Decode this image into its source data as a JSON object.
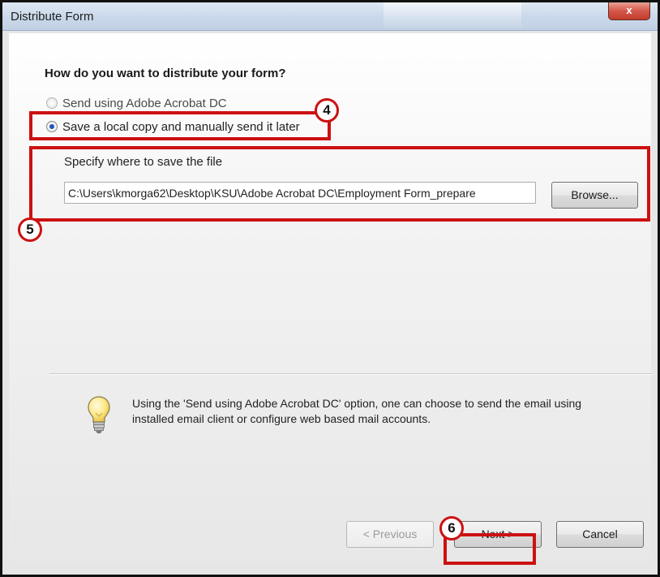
{
  "window": {
    "title": "Distribute Form",
    "close_label": "x"
  },
  "question": "How do you want to distribute your form?",
  "options": [
    {
      "label": "Send using Adobe Acrobat DC",
      "selected": false
    },
    {
      "label": "Save a local copy and manually send it later",
      "selected": true
    }
  ],
  "save_location": {
    "label": "Specify where to save the file",
    "value": "C:\\Users\\kmorga62\\Desktop\\KSU\\Adobe Acrobat DC\\Employment Form_prepare",
    "browse_label": "Browse..."
  },
  "tip": {
    "icon": "lightbulb-icon",
    "text": "Using the 'Send using Adobe Acrobat DC' option, one can choose to send the email using installed email client or configure web based mail accounts."
  },
  "buttons": {
    "previous": "< Previous",
    "next": "Next >",
    "cancel": "Cancel"
  },
  "annotations": {
    "step4": "4",
    "step5": "5",
    "step6": "6",
    "color": "#cc1111"
  }
}
